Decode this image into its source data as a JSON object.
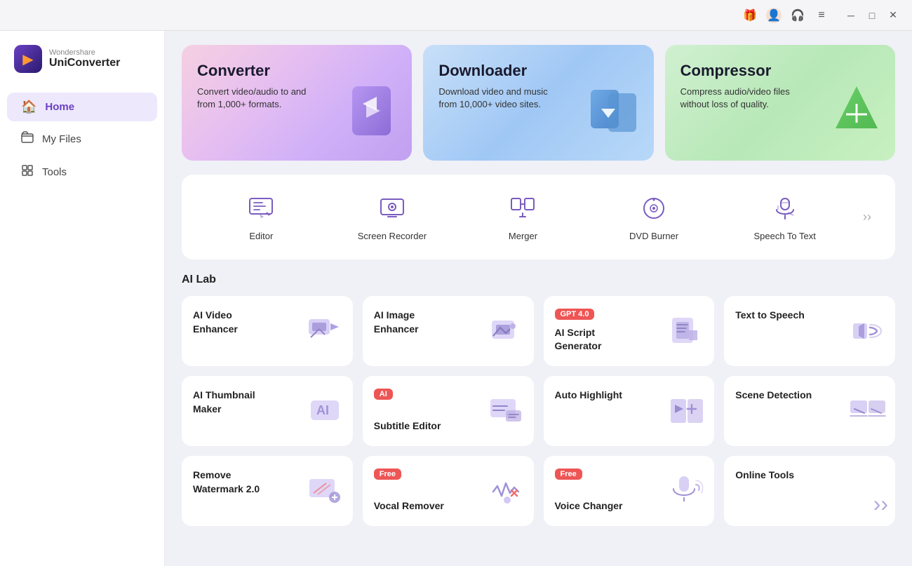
{
  "titlebar": {
    "icons": [
      "gift",
      "user",
      "headset",
      "menu"
    ],
    "controls": [
      "minimize",
      "maximize",
      "close"
    ]
  },
  "sidebar": {
    "brand": "Wondershare",
    "name": "UniConverter",
    "nav": [
      {
        "id": "home",
        "label": "Home",
        "icon": "🏠",
        "active": true
      },
      {
        "id": "myfiles",
        "label": "My Files",
        "icon": "📁",
        "active": false
      },
      {
        "id": "tools",
        "label": "Tools",
        "icon": "🧰",
        "active": false
      }
    ]
  },
  "hero": [
    {
      "id": "converter",
      "title": "Converter",
      "desc": "Convert video/audio to and from 1,000+ formats.",
      "icon": "🔄"
    },
    {
      "id": "downloader",
      "title": "Downloader",
      "desc": "Download video and music from 10,000+ video sites.",
      "icon": "📥"
    },
    {
      "id": "compressor",
      "title": "Compressor",
      "desc": "Compress audio/video files without loss of quality.",
      "icon": "📦"
    }
  ],
  "tools": [
    {
      "id": "editor",
      "label": "Editor"
    },
    {
      "id": "screen-recorder",
      "label": "Screen Recorder"
    },
    {
      "id": "merger",
      "label": "Merger"
    },
    {
      "id": "dvd-burner",
      "label": "DVD Burner"
    },
    {
      "id": "speech-to-text",
      "label": "Speech To Text"
    }
  ],
  "ai_lab": {
    "title": "AI Lab",
    "cards": [
      {
        "id": "ai-video-enhancer",
        "label": "AI Video\nEnhancer",
        "badge": null,
        "badge_type": null
      },
      {
        "id": "ai-image-enhancer",
        "label": "AI Image\nEnhancer",
        "badge": null,
        "badge_type": null
      },
      {
        "id": "ai-script-generator",
        "label": "AI Script\nGenerator",
        "badge": "GPT 4.0",
        "badge_type": "gpt"
      },
      {
        "id": "text-to-speech",
        "label": "Text to Speech",
        "badge": null,
        "badge_type": null
      },
      {
        "id": "ai-thumbnail-maker",
        "label": "AI Thumbnail\nMaker",
        "badge": null,
        "badge_type": null
      },
      {
        "id": "subtitle-editor",
        "label": "Subtitle Editor",
        "badge": "AI",
        "badge_type": "ai"
      },
      {
        "id": "auto-highlight",
        "label": "Auto Highlight",
        "badge": null,
        "badge_type": null
      },
      {
        "id": "scene-detection",
        "label": "Scene Detection",
        "badge": null,
        "badge_type": null
      },
      {
        "id": "remove-watermark",
        "label": "Remove\nWatermark 2.0",
        "badge": null,
        "badge_type": null
      },
      {
        "id": "vocal-remover",
        "label": "Vocal Remover",
        "badge": "Free",
        "badge_type": "free"
      },
      {
        "id": "voice-changer",
        "label": "Voice Changer",
        "badge": "Free",
        "badge_type": "free"
      },
      {
        "id": "online-tools",
        "label": "Online Tools",
        "badge": null,
        "badge_type": null
      }
    ]
  }
}
